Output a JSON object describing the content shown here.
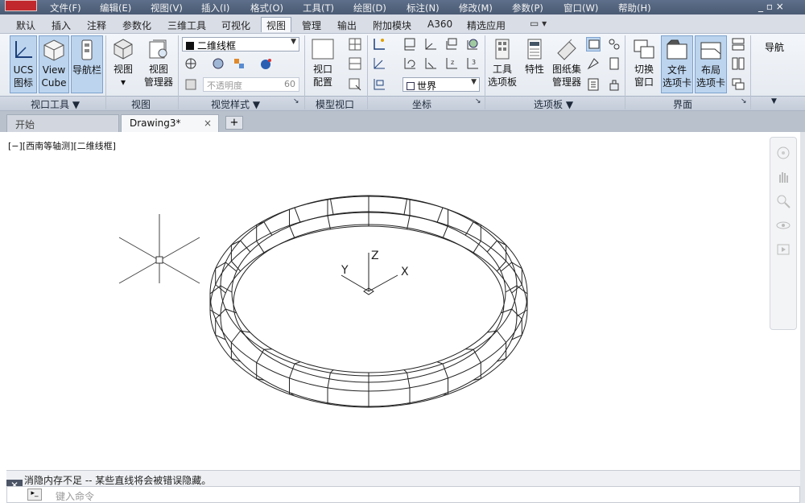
{
  "menubar": {
    "items": [
      "文件(F)",
      "编辑(E)",
      "视图(V)",
      "插入(I)",
      "格式(O)",
      "工具(T)",
      "绘图(D)",
      "标注(N)",
      "修改(M)",
      "参数(P)",
      "窗口(W)",
      "帮助(H)"
    ],
    "window_controls": "_ ▫ ×"
  },
  "ribbon_tabs": {
    "items": [
      "默认",
      "插入",
      "注释",
      "参数化",
      "三维工具",
      "可视化",
      "视图",
      "管理",
      "输出",
      "附加模块",
      "A360",
      "精选应用"
    ],
    "active": "视图",
    "extra": "▭ ▾"
  },
  "ribbon": {
    "viewport_tools": {
      "title": "视口工具 ▼",
      "ucs_icon": [
        "UCS",
        "图标"
      ],
      "view_cube": [
        "View",
        "Cube"
      ],
      "nav_bar": "导航栏"
    },
    "views": {
      "title": "视图",
      "view": "视图",
      "view_manager": [
        "视图",
        "管理器"
      ]
    },
    "visual_styles": {
      "title": "视觉样式 ▼",
      "style_combo": "二维线框",
      "slider_label": "不透明度",
      "slider_value": "60"
    },
    "model_viewports": {
      "title": "模型视口",
      "viewport_config": [
        "视口",
        "配置"
      ]
    },
    "coordinates": {
      "title": "坐标",
      "ucs_combo": "世界"
    },
    "palettes": {
      "title": "选项板 ▼",
      "tool_palettes": [
        "工具",
        "选项板"
      ],
      "properties": "特性",
      "sheet_set": [
        "图纸集",
        "管理器"
      ]
    },
    "interface": {
      "title": "界面",
      "switch_window": [
        "切换",
        "窗口"
      ],
      "file_tabs": [
        "文件",
        "选项卡"
      ],
      "layout_tabs": [
        "布局",
        "选项卡"
      ]
    },
    "navigate": {
      "title": "导航"
    }
  },
  "doc_tabs": {
    "start": "开始",
    "current": "Drawing3*",
    "close": "×",
    "add": "+"
  },
  "viewport": {
    "label": "[−][西南等轴测][二维线框]",
    "axis_x": "X",
    "axis_y": "Y",
    "axis_z": "Z"
  },
  "command": {
    "history": "消隐内存不足  --  某些直线将会被错误隐藏。",
    "placeholder": "键入命令",
    "close": "✕"
  },
  "colors": {
    "menubar": "#4f5f78",
    "ribbon_bg": "#e9edf3",
    "highlight": "#bcd4ee"
  }
}
